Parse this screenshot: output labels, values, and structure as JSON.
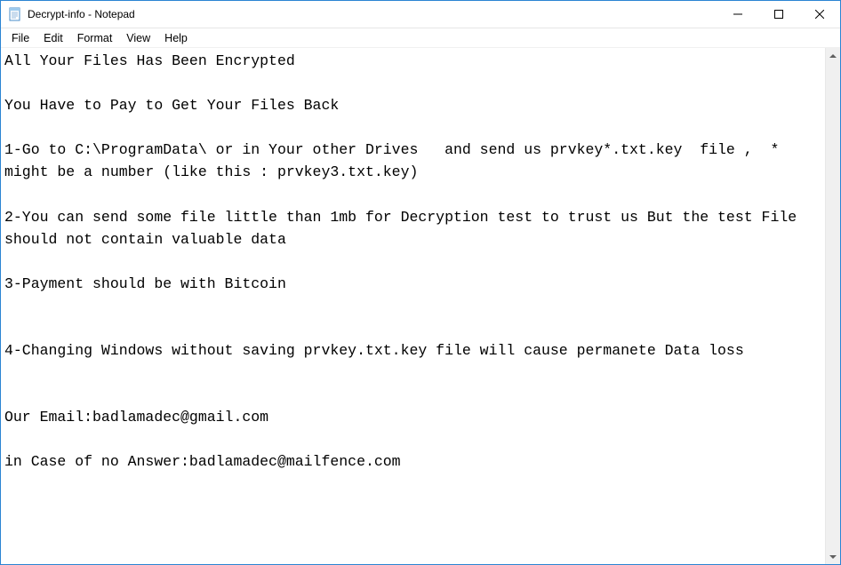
{
  "window": {
    "title": "Decrypt-info - Notepad"
  },
  "menu": {
    "file": "File",
    "edit": "Edit",
    "format": "Format",
    "view": "View",
    "help": "Help"
  },
  "content": {
    "text": "All Your Files Has Been Encrypted\n\nYou Have to Pay to Get Your Files Back\n\n1-Go to C:\\ProgramData\\ or in Your other Drives   and send us prvkey*.txt.key  file ,  *  might be a number (like this : prvkey3.txt.key)\n\n2-You can send some file little than 1mb for Decryption test to trust us But the test File should not contain valuable data\n\n3-Payment should be with Bitcoin\n\n\n4-Changing Windows without saving prvkey.txt.key file will cause permanete Data loss\n\n\nOur Email:badlamadec@gmail.com\n\nin Case of no Answer:badlamadec@mailfence.com"
  }
}
